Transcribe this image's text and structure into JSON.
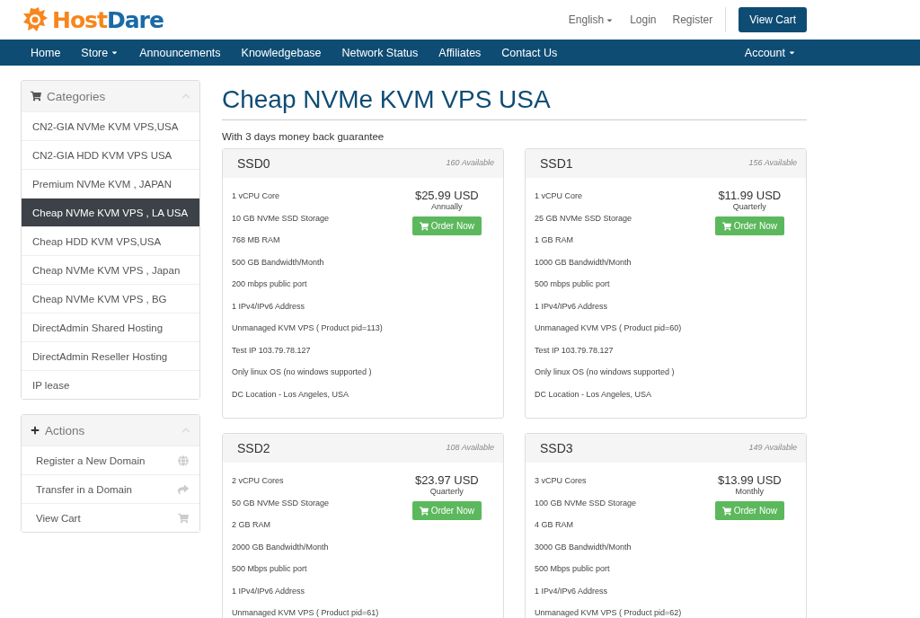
{
  "logo": [
    "Host",
    "Dare"
  ],
  "top_links": [
    {
      "label": "English",
      "caret": true
    },
    {
      "label": "Login",
      "caret": false
    },
    {
      "label": "Register",
      "caret": false
    }
  ],
  "view_cart": "View Cart",
  "nav": [
    {
      "label": "Home",
      "caret": false
    },
    {
      "label": "Store",
      "caret": true
    },
    {
      "label": "Announcements",
      "caret": false
    },
    {
      "label": "Knowledgebase",
      "caret": false
    },
    {
      "label": "Network Status",
      "caret": false
    },
    {
      "label": "Affiliates",
      "caret": false
    },
    {
      "label": "Contact Us",
      "caret": false
    }
  ],
  "nav_right": {
    "label": "Account",
    "caret": true
  },
  "categories": {
    "title": "Categories",
    "items": [
      {
        "label": "CN2-GIA NVMe KVM VPS,USA",
        "selected": false
      },
      {
        "label": "CN2-GIA HDD KVM VPS USA",
        "selected": false
      },
      {
        "label": "Premium NVMe KVM , JAPAN",
        "selected": false
      },
      {
        "label": "Cheap NVMe KVM VPS , LA USA",
        "selected": true
      },
      {
        "label": "Cheap HDD KVM VPS,USA",
        "selected": false
      },
      {
        "label": "Cheap NVMe KVM VPS , Japan",
        "selected": false
      },
      {
        "label": "Cheap NVMe KVM VPS , BG",
        "selected": false
      },
      {
        "label": "DirectAdmin Shared Hosting",
        "selected": false
      },
      {
        "label": "DirectAdmin Reseller Hosting",
        "selected": false
      },
      {
        "label": "IP lease",
        "selected": false
      }
    ]
  },
  "actions": {
    "title": "Actions",
    "items": [
      {
        "label": "Register a New Domain",
        "kind": "globe"
      },
      {
        "label": "Transfer in a Domain",
        "kind": "share"
      },
      {
        "label": "View Cart",
        "kind": "cart"
      }
    ]
  },
  "heading": "Cheap NVMe KVM VPS USA",
  "tagline": "With 3 days money back guarantee",
  "products": [
    {
      "name": "SSD0",
      "available": "160 Available",
      "price": "$25.99 USD",
      "cycle": "Annually",
      "button": "Order Now",
      "features": [
        "1 vCPU Core",
        "10 GB NVMe SSD Storage",
        "768 MB RAM",
        "500 GB Bandwidth/Month",
        "200 mbps public port",
        "1 IPv4/IPv6 Address",
        "Unmanaged KVM VPS ( Product pid=113)",
        "Test IP 103.79.78.127",
        "Only linux OS (no windows supported )",
        "DC Location - Los Angeles, USA"
      ]
    },
    {
      "name": "SSD1",
      "available": "156 Available",
      "price": "$11.99 USD",
      "cycle": "Quarterly",
      "button": "Order Now",
      "features": [
        "1 vCPU Core",
        "25 GB NVMe SSD Storage",
        "1 GB RAM",
        "1000 GB Bandwidth/Month",
        "500 mbps public port",
        "1 IPv4/IPv6 Address",
        "Unmanaged KVM VPS ( Product pid=60)",
        "Test IP 103.79.78.127",
        "Only linux OS (no windows supported )",
        "DC Location - Los Angeles, USA"
      ]
    },
    {
      "name": "SSD2",
      "available": "108 Available",
      "price": "$23.97 USD",
      "cycle": "Quarterly",
      "button": "Order Now",
      "features": [
        "2 vCPU Cores",
        "50 GB NVMe SSD Storage",
        "2 GB RAM",
        "2000 GB Bandwidth/Month",
        "500 Mbps public port",
        "1 IPv4/IPv6 Address",
        "Unmanaged KVM VPS ( Product pid=61)"
      ]
    },
    {
      "name": "SSD3",
      "available": "149 Available",
      "price": "$13.99 USD",
      "cycle": "Monthly",
      "button": "Order Now",
      "features": [
        "3 vCPU Cores",
        "100 GB NVMe SSD Storage",
        "4 GB RAM",
        "3000 GB Bandwidth/Month",
        "500 Mbps public port",
        "1 IPv4/IPv6 Address",
        "Unmanaged KVM VPS ( Product pid=62)"
      ]
    }
  ]
}
